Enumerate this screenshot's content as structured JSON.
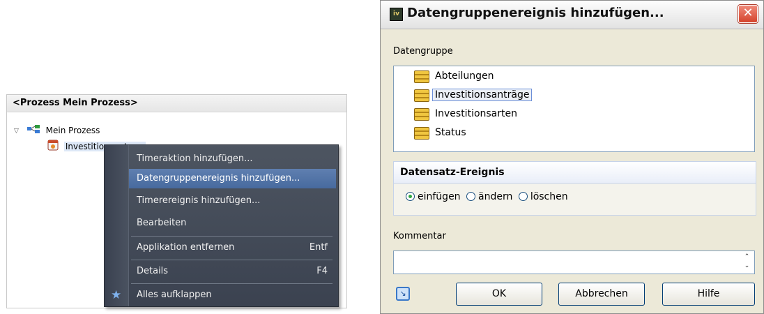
{
  "tree": {
    "header": "<Prozess Mein Prozess>",
    "root_label": "Mein Prozess",
    "child_label": "Investitionsantrag"
  },
  "context_menu": {
    "items": [
      {
        "label": "Timeraktion hinzufügen...",
        "shortcut": ""
      },
      {
        "label": "Datengruppenereignis hinzufügen...",
        "shortcut": ""
      },
      {
        "label": "Timerereignis hinzufügen...",
        "shortcut": ""
      },
      {
        "label": "Bearbeiten",
        "shortcut": ""
      },
      {
        "label": "Applikation entfernen",
        "shortcut": "Entf"
      },
      {
        "label": "Details",
        "shortcut": "F4"
      },
      {
        "label": "Alles aufklappen",
        "shortcut": ""
      }
    ],
    "highlighted_index": 1
  },
  "dialog": {
    "title": "Datengruppenereignis hinzufügen...",
    "datengruppe_label": "Datengruppe",
    "datengruppen": [
      "Abteilungen",
      "Investitionsanträge",
      "Investitionsarten",
      "Status"
    ],
    "selected_datengruppe": "Investitionsanträge",
    "group_title": "Datensatz-Ereignis",
    "radio_options": [
      "einfügen",
      "ändern",
      "löschen"
    ],
    "selected_radio": "einfügen",
    "comment_label": "Kommentar",
    "comment_value": "",
    "buttons": {
      "ok": "OK",
      "cancel": "Abbrechen",
      "help": "Hilfe"
    }
  },
  "colors": {
    "menu_bg": "#434a57",
    "menu_highlight": "#5577aa",
    "dialog_bg": "#ece9d8",
    "close_button": "#d4432c"
  }
}
